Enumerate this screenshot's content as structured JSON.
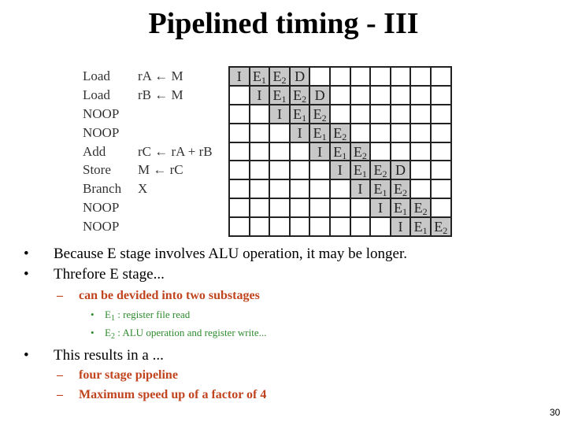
{
  "title": "Pipelined timing - III",
  "instructions": [
    {
      "op": "Load",
      "arg": "rA ← M"
    },
    {
      "op": "Load",
      "arg": "rB ← M"
    },
    {
      "op": "NOOP",
      "arg": ""
    },
    {
      "op": "NOOP",
      "arg": ""
    },
    {
      "op": "Add",
      "arg": "rC ← rA + rB"
    },
    {
      "op": "Store",
      "arg": "M ← rC"
    },
    {
      "op": "Branch",
      "arg": "X"
    },
    {
      "op": "NOOP",
      "arg": ""
    },
    {
      "op": "NOOP",
      "arg": ""
    }
  ],
  "timing_grid": {
    "columns": 11,
    "rows": [
      {
        "start": 0,
        "stages": [
          "I",
          "E1",
          "E2",
          "D"
        ]
      },
      {
        "start": 1,
        "stages": [
          "I",
          "E1",
          "E2",
          "D"
        ]
      },
      {
        "start": 2,
        "stages": [
          "I",
          "E1",
          "E2"
        ]
      },
      {
        "start": 3,
        "stages": [
          "I",
          "E1",
          "E2"
        ]
      },
      {
        "start": 4,
        "stages": [
          "I",
          "E1",
          "E2"
        ]
      },
      {
        "start": 5,
        "stages": [
          "I",
          "E1",
          "E2",
          "D"
        ]
      },
      {
        "start": 6,
        "stages": [
          "I",
          "E1",
          "E2"
        ]
      },
      {
        "start": 7,
        "stages": [
          "I",
          "E1",
          "E2"
        ]
      },
      {
        "start": 8,
        "stages": [
          "I",
          "E1",
          "E2"
        ]
      }
    ]
  },
  "bullets": {
    "b1": "Because E stage involves ALU operation, it may be longer.",
    "b2": "Threfore E stage...",
    "b2_sub": "can be devided into two substages",
    "e1_label": "E",
    "e1_sub": "1",
    "e1_text": " : register file read",
    "e2_label": "E",
    "e2_sub": "2",
    "e2_text": " : ALU operation and register write...",
    "b3": "This results in a ...",
    "b3_sub1": "four stage pipeline",
    "b3_sub2": "Maximum speed up of a factor of 4"
  },
  "symbols": {
    "bullet": "•",
    "dash": "–"
  },
  "colors": {
    "level2": "#c0441e",
    "level3": "#2e8b2e",
    "cell_fill": "#c8c8c8"
  },
  "page_number": "30"
}
